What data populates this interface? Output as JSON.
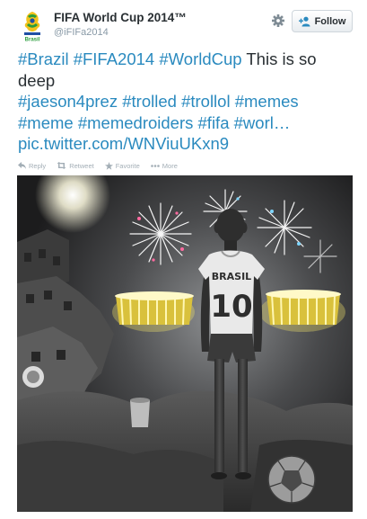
{
  "account": {
    "display_name": "FIFA World Cup 2014™",
    "screen_name": "@iFIFa2014",
    "avatar_icon": "fifa-world-cup-2014-logo",
    "avatar_logo_text": "Brasil"
  },
  "header": {
    "settings_icon": "gear-icon",
    "follow_label": "Follow",
    "follow_icon": "add-user-icon"
  },
  "tweet": {
    "hashtag_brazil": "#Brazil",
    "hashtag_fifa2014": "#FIFA2014",
    "hashtag_worldcup": "#WorldCup",
    "text_this_is_so": "This is so",
    "text_deep": "deep",
    "hashtag_jaeson4prez": "#jaeson4prez",
    "hashtag_trolled": "#trolled",
    "hashtag_trollol": "#trollol",
    "hashtag_memes": "#memes",
    "hashtag_meme": "#meme",
    "hashtag_memedroiders": "#memedroiders",
    "hashtag_fifa": "#fifa",
    "hashtag_truncated": "#worl…",
    "link": "pic.twitter.com/WNViuUKxn9"
  },
  "actions": {
    "reply": "Reply",
    "retweet": "Retweet",
    "favorite": "Favorite",
    "more": "More"
  },
  "image": {
    "jersey_name": "BRASIL",
    "jersey_number": "10"
  },
  "colors": {
    "link": "#2a8abf",
    "text": "#292f33",
    "muted": "#8899a6",
    "action": "#a3aeb6"
  }
}
